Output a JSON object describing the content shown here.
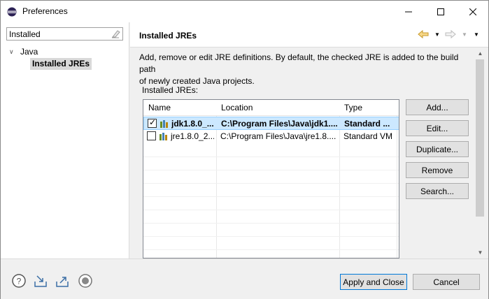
{
  "window": {
    "title": "Preferences"
  },
  "filter": {
    "value": "Installed"
  },
  "tree": {
    "java_label": "Java",
    "jres_label": "Installed JREs"
  },
  "page": {
    "title": "Installed JREs",
    "description_line1": "Add, remove or edit JRE definitions. By default, the checked JRE is added to the build path",
    "description_line2": "of newly created Java projects.",
    "installed_label": "Installed JREs:"
  },
  "table": {
    "columns": [
      "Name",
      "Location",
      "Type"
    ],
    "rows": [
      {
        "checked": true,
        "name": "jdk1.8.0_...",
        "location": "C:\\Program Files\\Java\\jdk1....",
        "type": "Standard ..."
      },
      {
        "checked": false,
        "name": "jre1.8.0_2...",
        "location": "C:\\Program Files\\Java\\jre1.8....",
        "type": "Standard VM"
      }
    ]
  },
  "buttons": {
    "add": "Add...",
    "edit": "Edit...",
    "duplicate": "Duplicate...",
    "remove": "Remove",
    "search": "Search...",
    "apply_close": "Apply and Close",
    "cancel": "Cancel"
  },
  "colors": {
    "selection": "#cce8ff",
    "accent": "#0078d7"
  }
}
